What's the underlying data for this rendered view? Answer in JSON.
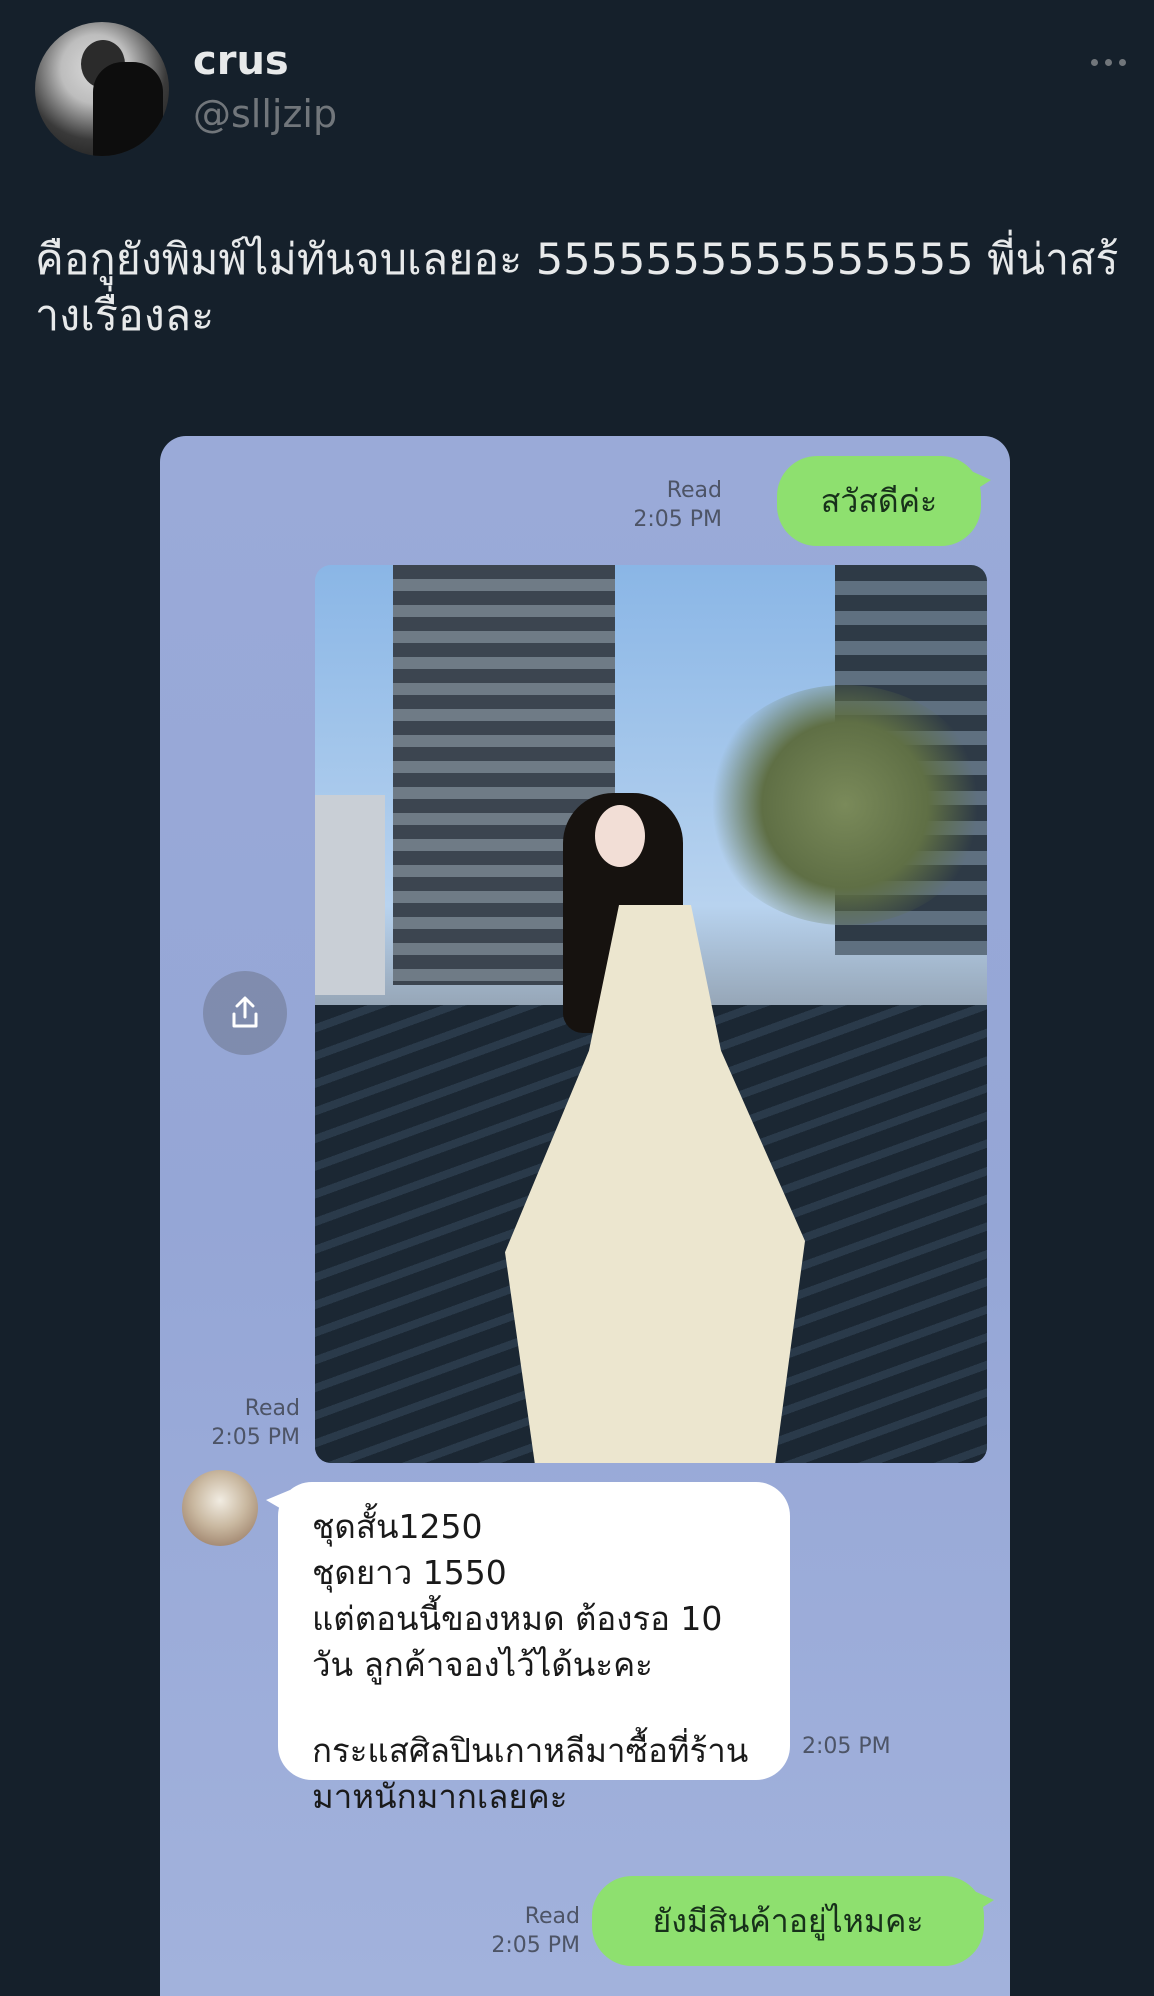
{
  "tweet": {
    "display_name": "crus",
    "handle": "@slljzip",
    "text": "คือกูยังพิมพ์ไม่ทันจบเลยอะ 5555555555555555 พี่น่าสร้างเรื่องละ",
    "more_icon": "more-horizontal-icon"
  },
  "chat": {
    "colors": {
      "background": "#95a6d6",
      "outgoing_bubble": "#8ee06f",
      "incoming_bubble": "#ffffff"
    },
    "messages": [
      {
        "direction": "out",
        "text": "สวัสดีค่ะ",
        "status": "Read",
        "time": "2:05 PM"
      },
      {
        "direction": "out",
        "type": "image",
        "status": "Read",
        "time": "2:05 PM"
      },
      {
        "direction": "in",
        "lines": [
          "ชุดสั้น1250",
          "ชุดยาว 1550",
          "แต่ตอนนี้ของหมด ต้องรอ 10",
          "วัน ลูกค้าจองไว้ได้นะคะ"
        ],
        "lines2": [
          "กระแสศิลปินเกาหลีมาซื้อที่ร้าน",
          "มาหนักมากเลยคะ"
        ],
        "time": "2:05 PM"
      },
      {
        "direction": "out",
        "text": "ยังมีสินค้าอยู่ไหมคะ",
        "status": "Read",
        "time": "2:05 PM"
      }
    ],
    "share_icon": "share-icon"
  }
}
